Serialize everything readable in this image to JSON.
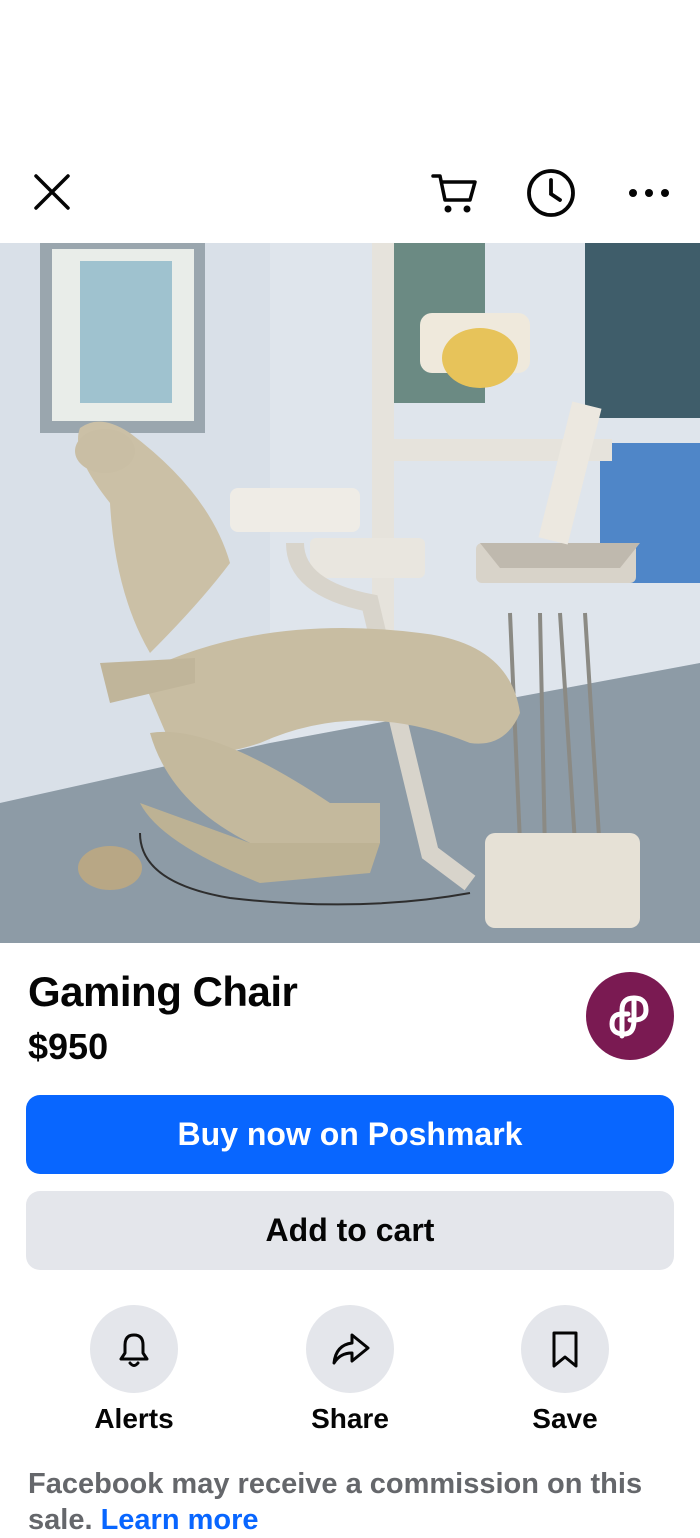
{
  "header": {
    "close_icon": "close-icon",
    "cart_icon": "cart-icon",
    "history_icon": "clock-icon",
    "more_icon": "more-horizontal-icon"
  },
  "listing": {
    "title": "Gaming Chair",
    "price": "$950",
    "image_count": 3,
    "active_image_index": 0,
    "seller_logo": "poshmark-logo",
    "seller_color": "#7a1a52"
  },
  "buttons": {
    "buy_now": "Buy now on Poshmark",
    "add_to_cart": "Add to cart"
  },
  "actions": [
    {
      "label": "Alerts",
      "icon": "bell-icon"
    },
    {
      "label": "Share",
      "icon": "share-arrow-icon"
    },
    {
      "label": "Save",
      "icon": "bookmark-icon"
    }
  ],
  "disclaimer": {
    "text": "Facebook may receive a commission on this sale.",
    "link": "Learn more"
  },
  "colors": {
    "primary": "#0866ff",
    "secondary_bg": "#e4e6eb",
    "muted_text": "#65676b"
  }
}
